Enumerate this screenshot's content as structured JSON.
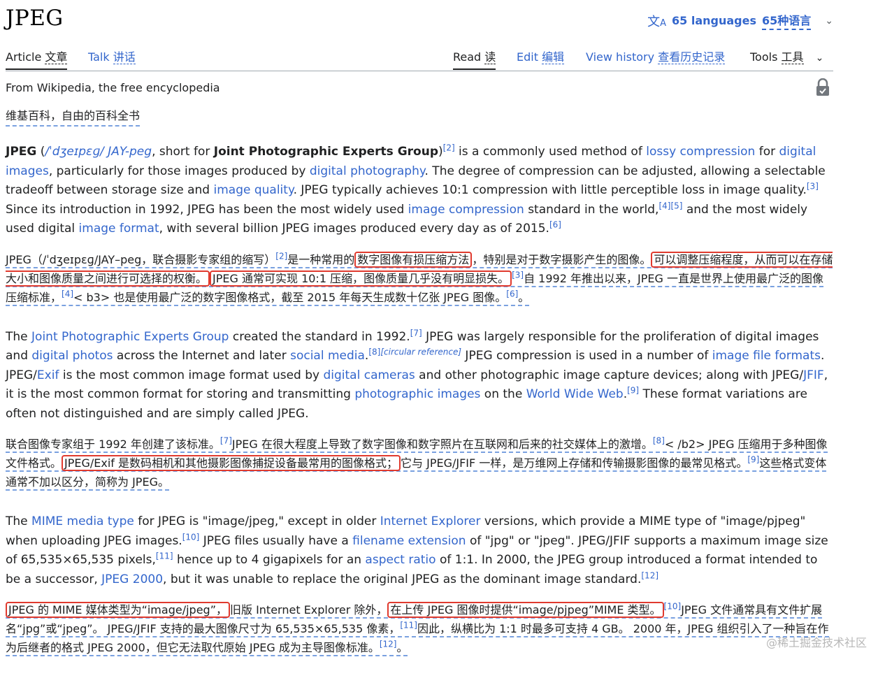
{
  "header": {
    "title": "JPEG",
    "languages_en": "65 languages",
    "languages_zh": "65种语言",
    "lang_icon": "translate-icon",
    "chevron": "⌄"
  },
  "tabs": {
    "article_en": "Article",
    "article_zh": "文章",
    "talk_en": "Talk",
    "talk_zh": "讲话",
    "read_en": "Read",
    "read_zh": "读",
    "edit_en": "Edit",
    "edit_zh": "编辑",
    "history_en": "View history",
    "history_zh": "查看历史记录",
    "tools_en": "Tools",
    "tools_zh": "工具"
  },
  "tagline_en": "From Wikipedia, the free encyclopedia",
  "tagline_zh": "维基百科，自由的百科全书",
  "watermark": "@稀土掘金技术社区",
  "colors": {
    "link": "#3366cc",
    "highlight": "#e03a2e",
    "dash": "#7aa1e0"
  },
  "paragraphs": [
    {
      "lang": "en",
      "segments": [
        {
          "t": "b",
          "v": "JPEG"
        },
        {
          "t": "s",
          "v": " ("
        },
        {
          "t": "ipa",
          "v": "/ˈdʒeɪpɛɡ/"
        },
        {
          "t": "s",
          "v": " "
        },
        {
          "t": "ipa",
          "v": "JAY-peg"
        },
        {
          "t": "s",
          "v": ", short for "
        },
        {
          "t": "b",
          "v": "Joint Photographic Experts Group"
        },
        {
          "t": "s",
          "v": ")"
        },
        {
          "t": "r",
          "v": "[2]"
        },
        {
          "t": "s",
          "v": " is a commonly used method of "
        },
        {
          "t": "a",
          "v": "lossy compression"
        },
        {
          "t": "s",
          "v": " for "
        },
        {
          "t": "a",
          "v": "digital images"
        },
        {
          "t": "s",
          "v": ", particularly for those images produced by "
        },
        {
          "t": "a",
          "v": "digital photography"
        },
        {
          "t": "s",
          "v": ". The degree of compression can be adjusted, allowing a selectable tradeoff between storage size and "
        },
        {
          "t": "a",
          "v": "image quality"
        },
        {
          "t": "s",
          "v": ". JPEG typically achieves 10:1 compression with little perceptible loss in image quality."
        },
        {
          "t": "r",
          "v": "[3]"
        },
        {
          "t": "s",
          "v": " Since its introduction in 1992, JPEG has been the most widely used "
        },
        {
          "t": "a",
          "v": "image compression"
        },
        {
          "t": "s",
          "v": " standard in the world,"
        },
        {
          "t": "r",
          "v": "[4]"
        },
        {
          "t": "r",
          "v": "[5]"
        },
        {
          "t": "s",
          "v": " and the most widely used digital "
        },
        {
          "t": "a",
          "v": "image format"
        },
        {
          "t": "s",
          "v": ", with several billion JPEG images produced every day as of 2015."
        },
        {
          "t": "r",
          "v": "[6]"
        }
      ]
    },
    {
      "lang": "zh",
      "segments": [
        {
          "t": "s",
          "v": "JPEG（/ˈdʒeɪpɛɡ/JAY–peg，联合摄影专家组的缩写）"
        },
        {
          "t": "r",
          "v": "[2]"
        },
        {
          "t": "s",
          "v": "是一种常用的"
        },
        {
          "t": "h",
          "v": "数字图像有损压缩方法"
        },
        {
          "t": "s",
          "v": "，特别是对于数字摄影产生的图像。"
        },
        {
          "t": "h",
          "v": "可以调整压缩程度，从而可以在存储大小和图像质量之间进行可选择的权衡。"
        },
        {
          "t": "h",
          "v": "JPEG 通常可实现 10:1 压缩，图像质量几乎没有明显损失。"
        },
        {
          "t": "r",
          "v": "[3]"
        },
        {
          "t": "s",
          "v": "自 1992 年推出以来，JPEG 一直是世界上使用最广泛的图像压缩标准，"
        },
        {
          "t": "r",
          "v": "[4]"
        },
        {
          "t": "s",
          "v": "< b3> 也是使用最广泛的数字图像格式，截至 2015 年每天生成数十亿张 JPEG 图像。"
        },
        {
          "t": "r",
          "v": "[6]"
        },
        {
          "t": "s",
          "v": "。"
        }
      ]
    },
    {
      "lang": "en",
      "segments": [
        {
          "t": "s",
          "v": "The "
        },
        {
          "t": "a",
          "v": "Joint Photographic Experts Group"
        },
        {
          "t": "s",
          "v": " created the standard in 1992."
        },
        {
          "t": "r",
          "v": "[7]"
        },
        {
          "t": "s",
          "v": " JPEG was largely responsible for the proliferation of digital images and "
        },
        {
          "t": "a",
          "v": "digital photos"
        },
        {
          "t": "s",
          "v": " across the Internet and later "
        },
        {
          "t": "a",
          "v": "social media"
        },
        {
          "t": "s",
          "v": "."
        },
        {
          "t": "r",
          "v": "[8]"
        },
        {
          "t": "ri",
          "v": "[circular reference]"
        },
        {
          "t": "s",
          "v": " JPEG compression is used in a number of "
        },
        {
          "t": "a",
          "v": "image file formats"
        },
        {
          "t": "s",
          "v": ". JPEG/"
        },
        {
          "t": "a",
          "v": "Exif"
        },
        {
          "t": "s",
          "v": " is the most common image format used by "
        },
        {
          "t": "a",
          "v": "digital cameras"
        },
        {
          "t": "s",
          "v": " and other photographic image capture devices; along with JPEG/"
        },
        {
          "t": "a",
          "v": "JFIF"
        },
        {
          "t": "s",
          "v": ", it is the most common format for storing and transmitting "
        },
        {
          "t": "a",
          "v": "photographic images"
        },
        {
          "t": "s",
          "v": " on the "
        },
        {
          "t": "a",
          "v": "World Wide Web"
        },
        {
          "t": "s",
          "v": "."
        },
        {
          "t": "r",
          "v": "[9]"
        },
        {
          "t": "s",
          "v": " These format variations are often not distinguished and are simply called JPEG."
        }
      ]
    },
    {
      "lang": "zh",
      "segments": [
        {
          "t": "s",
          "v": "联合图像专家组于 1992 年创建了该标准。"
        },
        {
          "t": "r",
          "v": "[7]"
        },
        {
          "t": "s",
          "v": "JPEG 在很大程度上导致了数字图像和数字照片在互联网和后来的社交媒体上的激增。"
        },
        {
          "t": "r",
          "v": "[8]"
        },
        {
          "t": "s",
          "v": "< /b2> JPEG 压缩用于多种图像文件格式。"
        },
        {
          "t": "h",
          "v": "JPEG/Exif 是数码相机和其他摄影图像捕捉设备最常用的图像格式；"
        },
        {
          "t": "s",
          "v": "它与 JPEG/JFIF 一样，是万维网上存储和传输摄影图像的最常见格式。"
        },
        {
          "t": "r",
          "v": "[9]"
        },
        {
          "t": "s",
          "v": "这些格式变体通常不加以区分，简称为 JPEG。"
        }
      ]
    },
    {
      "lang": "en",
      "segments": [
        {
          "t": "s",
          "v": "The "
        },
        {
          "t": "a",
          "v": "MIME media type"
        },
        {
          "t": "s",
          "v": " for JPEG is \"image/jpeg,\" except in older "
        },
        {
          "t": "a",
          "v": "Internet Explorer"
        },
        {
          "t": "s",
          "v": " versions, which provide a MIME type of \"image/pjpeg\" when uploading JPEG images."
        },
        {
          "t": "r",
          "v": "[10]"
        },
        {
          "t": "s",
          "v": " JPEG files usually have a "
        },
        {
          "t": "a",
          "v": "filename extension"
        },
        {
          "t": "s",
          "v": " of \"jpg\" or \"jpeg\". JPEG/JFIF supports a maximum image size of 65,535×65,535 pixels,"
        },
        {
          "t": "r",
          "v": "[11]"
        },
        {
          "t": "s",
          "v": " hence up to 4 gigapixels for an "
        },
        {
          "t": "a",
          "v": "aspect ratio"
        },
        {
          "t": "s",
          "v": " of 1:1. In 2000, the JPEG group introduced a format intended to be a successor, "
        },
        {
          "t": "a",
          "v": "JPEG 2000"
        },
        {
          "t": "s",
          "v": ", but it was unable to replace the original JPEG as the dominant image standard."
        },
        {
          "t": "r",
          "v": "[12]"
        }
      ]
    },
    {
      "lang": "zh",
      "segments": [
        {
          "t": "h",
          "v": "JPEG 的 MIME 媒体类型为“image/jpeg”，"
        },
        {
          "t": "s",
          "v": "旧版 Internet Explorer 除外，"
        },
        {
          "t": "h",
          "v": "在上传 JPEG 图像时提供“image/pjpeg”MIME 类型。"
        },
        {
          "t": "r",
          "v": "[10]"
        },
        {
          "t": "s",
          "v": "JPEG 文件通常具有文件扩展名“jpg”或“jpeg”。 JPEG/JFIF 支持的最大图像尺寸为 65,535×65,535 像素，"
        },
        {
          "t": "r",
          "v": "[11]"
        },
        {
          "t": "s",
          "v": "因此，纵横比为 1:1 时最多可支持 4 GB。 2000 年，JPEG 组织引入了一种旨在作为后继者的格式 JPEG 2000，但它无法取代原始 JPEG 成为主导图像标准。"
        },
        {
          "t": "r",
          "v": "[12]"
        },
        {
          "t": "s",
          "v": "。"
        }
      ]
    }
  ]
}
